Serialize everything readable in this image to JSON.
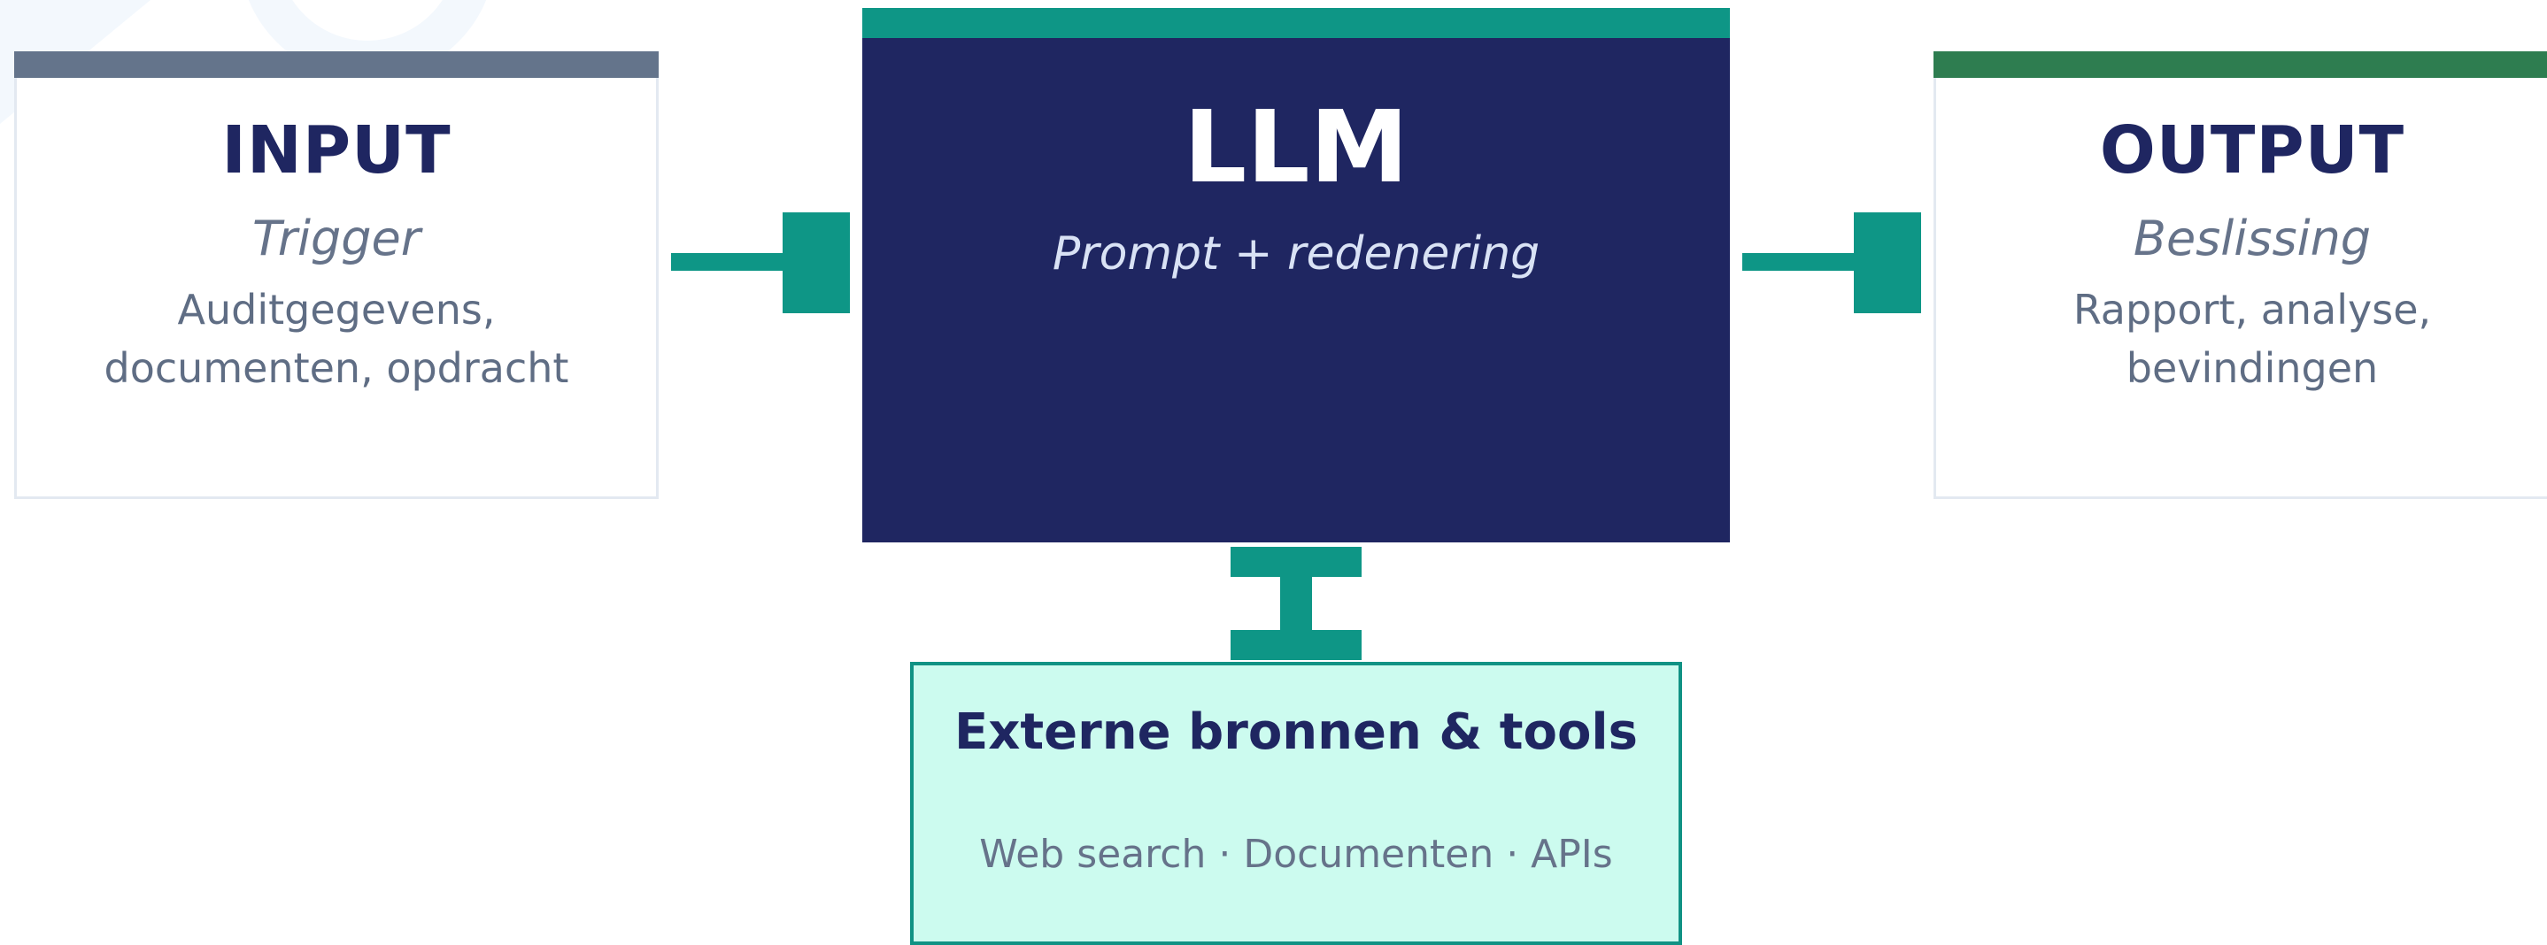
{
  "colors": {
    "navy": "#1f2661",
    "teal": "#0e9686",
    "input_accent": "#64748b",
    "output_accent": "#2e7d50",
    "external_fill": "#ccfbef",
    "muted_text": "#66738a"
  },
  "input": {
    "title": "INPUT",
    "subtitle": "Trigger",
    "desc_line1": "Auditgegevens,",
    "desc_line2": "documenten, opdracht"
  },
  "llm": {
    "title": "LLM",
    "subtitle": "Prompt + redenering"
  },
  "output": {
    "title": "OUTPUT",
    "subtitle": "Beslissing",
    "desc_line1": "Rapport, analyse,",
    "desc_line2": "bevindingen"
  },
  "external": {
    "title": "Externe bronnen & tools",
    "desc": "Web search · Documenten · APIs"
  }
}
